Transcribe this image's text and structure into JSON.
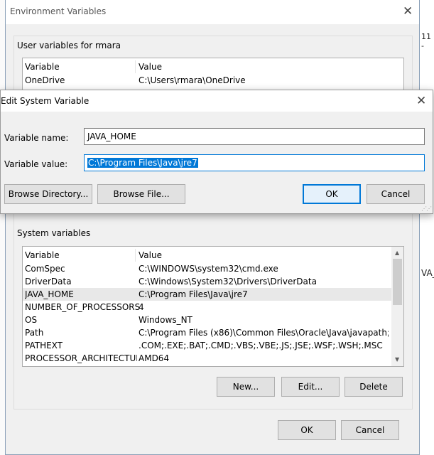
{
  "env_dialog": {
    "title": "Environment Variables",
    "user_section": {
      "label": "User variables for rmara",
      "headers": {
        "variable": "Variable",
        "value": "Value"
      },
      "rows": [
        {
          "variable": "OneDrive",
          "value": "C:\\Users\\rmara\\OneDrive"
        }
      ]
    },
    "system_section": {
      "label": "System variables",
      "headers": {
        "variable": "Variable",
        "value": "Value"
      },
      "rows": [
        {
          "variable": "ComSpec",
          "value": "C:\\WINDOWS\\system32\\cmd.exe"
        },
        {
          "variable": "DriverData",
          "value": "C:\\Windows\\System32\\Drivers\\DriverData"
        },
        {
          "variable": "JAVA_HOME",
          "value": "C:\\Program Files\\Java\\jre7"
        },
        {
          "variable": "NUMBER_OF_PROCESSORS",
          "value": "4"
        },
        {
          "variable": "OS",
          "value": "Windows_NT"
        },
        {
          "variable": "Path",
          "value": "C:\\Program Files (x86)\\Common Files\\Oracle\\Java\\javapath;C:\\..."
        },
        {
          "variable": "PATHEXT",
          "value": ".COM;.EXE;.BAT;.CMD;.VBS;.VBE;.JS;.JSE;.WSF;.WSH;.MSC"
        },
        {
          "variable": "PROCESSOR_ARCHITECTURE",
          "value": "AMD64"
        }
      ],
      "selected_row": "JAVA_HOME",
      "buttons": {
        "new": "New...",
        "edit": "Edit...",
        "delete": "Delete"
      }
    },
    "buttons": {
      "ok": "OK",
      "cancel": "Cancel"
    }
  },
  "edit_dialog": {
    "title": "Edit System Variable",
    "name_label": "Variable name:",
    "name_value": "JAVA_HOME",
    "value_label": "Variable value:",
    "value_value": "C:\\Program Files\\Java\\jre7",
    "buttons": {
      "browse_directory": "Browse Directory...",
      "browse_file": "Browse File...",
      "ok": "OK",
      "cancel": "Cancel"
    }
  },
  "background": {
    "right_snippet_top": "11 -",
    "right_snippet_mid": "VA_"
  },
  "icons": [
    "close-icon",
    "scroll-up-icon",
    "scroll-down-icon",
    "resize-grip-icon"
  ],
  "colors": {
    "accent": "#0078d7",
    "selection": "#0078d7",
    "row_highlight": "#e8e8e8"
  }
}
